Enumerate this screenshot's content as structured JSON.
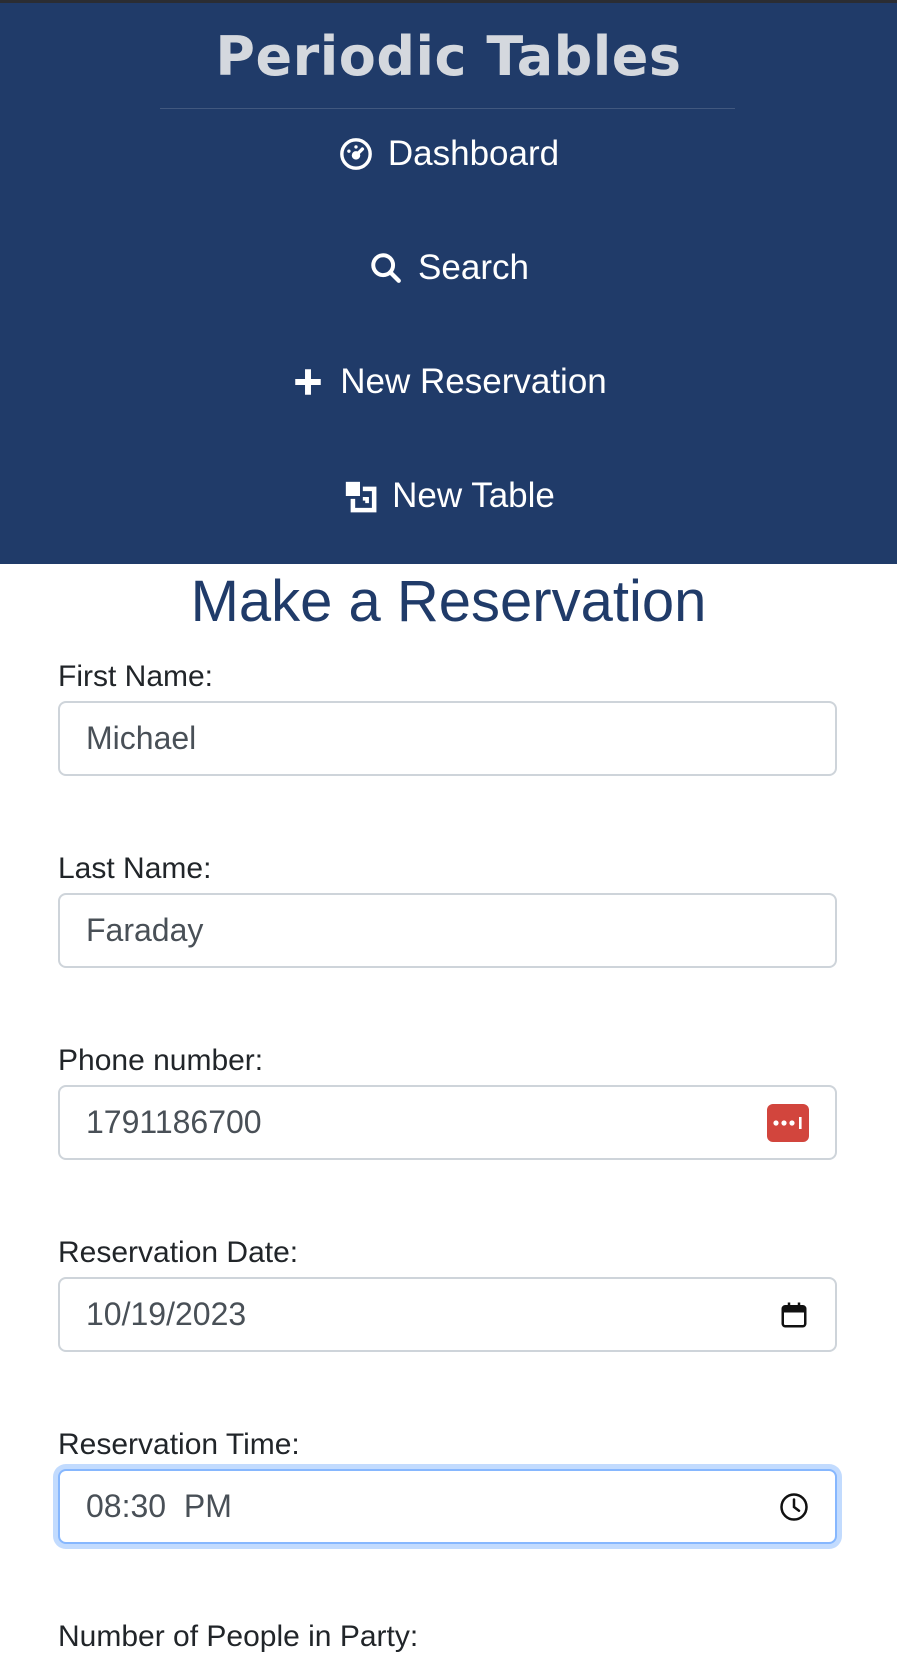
{
  "app": {
    "brand": "Periodic Tables"
  },
  "nav": {
    "items": [
      {
        "label": "Dashboard",
        "icon": "dashboard-icon"
      },
      {
        "label": "Search",
        "icon": "search-icon"
      },
      {
        "label": "New Reservation",
        "icon": "plus-icon"
      },
      {
        "label": "New Table",
        "icon": "layers-icon"
      }
    ]
  },
  "page": {
    "title": "Make a Reservation"
  },
  "form": {
    "first_name": {
      "label": "First Name:",
      "value": "Michael"
    },
    "last_name": {
      "label": "Last Name:",
      "value": "Faraday"
    },
    "phone": {
      "label": "Phone number:",
      "value": "1791186700",
      "icon": "password-manager-icon"
    },
    "date": {
      "label": "Reservation Date:",
      "value": "10/19/2023",
      "icon": "calendar-icon"
    },
    "time": {
      "label": "Reservation Time:",
      "value": "08:30  PM",
      "icon": "clock-icon"
    },
    "people": {
      "label": "Number of People in Party:"
    }
  },
  "colors": {
    "nav_background": "#203b69",
    "title_color": "#203b69",
    "password_icon_bg": "#d2453d",
    "focus_ring": "#86b7fe"
  }
}
